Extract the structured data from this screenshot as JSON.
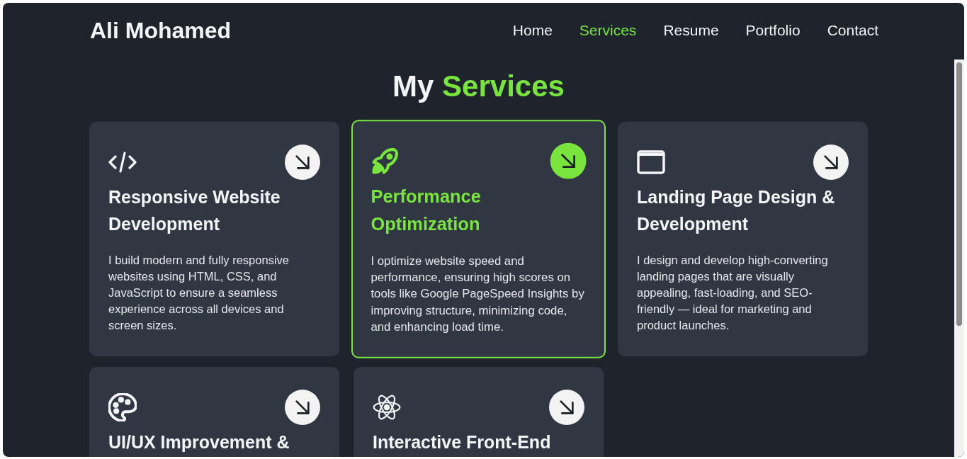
{
  "header": {
    "logo": "Ali Mohamed",
    "nav": [
      {
        "label": "Home",
        "selected": false
      },
      {
        "label": "Services",
        "selected": true
      },
      {
        "label": "Resume",
        "selected": false
      },
      {
        "label": "Portfolio",
        "selected": false
      },
      {
        "label": "Contact",
        "selected": false
      }
    ]
  },
  "heading": {
    "text": "My",
    "accent": "Services"
  },
  "cards": [
    {
      "title": "Responsive Website Development",
      "description": "I build modern and fully responsive websites using HTML, CSS, and JavaScript to ensure a seamless experience across all devices and screen sizes.",
      "selected": false
    },
    {
      "title": "Performance Optimization",
      "description": "I optimize website speed and performance, ensuring high scores on tools like Google PageSpeed Insights by improving structure, minimizing code, and enhancing load time.",
      "selected": true
    },
    {
      "title": "Landing Page Design & Development",
      "description": "I design and develop high-converting landing pages that are visually appealing, fast-loading, and SEO-friendly — ideal for marketing and product launches.",
      "selected": false
    },
    {
      "title": "UI/UX Improvement &",
      "selected": false
    },
    {
      "title": "Interactive Front-End",
      "selected": false
    }
  ]
}
